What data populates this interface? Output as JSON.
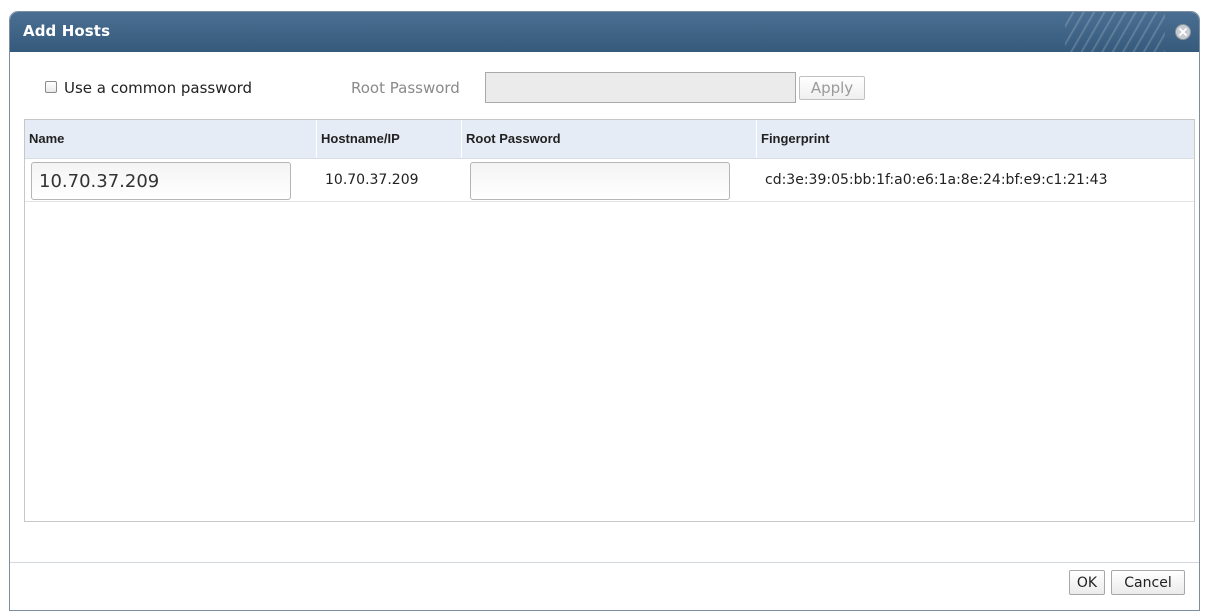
{
  "dialog": {
    "title": "Add Hosts"
  },
  "toolbar": {
    "common_password_label": "Use a common password",
    "common_password_checked": false,
    "root_password_label": "Root Password",
    "root_password_value": "",
    "apply_label": "Apply"
  },
  "grid": {
    "columns": [
      "Name",
      "Hostname/IP",
      "Root Password",
      "Fingerprint"
    ],
    "rows": [
      {
        "name": "10.70.37.209",
        "hostname": "10.70.37.209",
        "root_password": "",
        "fingerprint": "cd:3e:39:05:bb:1f:a0:e6:1a:8e:24:bf:e9:c1:21:43"
      }
    ]
  },
  "footer": {
    "ok_label": "OK",
    "cancel_label": "Cancel"
  },
  "colors": {
    "titlebar": "#3a5e80",
    "header_bg": "#e6ecf6"
  },
  "icons": {
    "close": "close-icon"
  }
}
